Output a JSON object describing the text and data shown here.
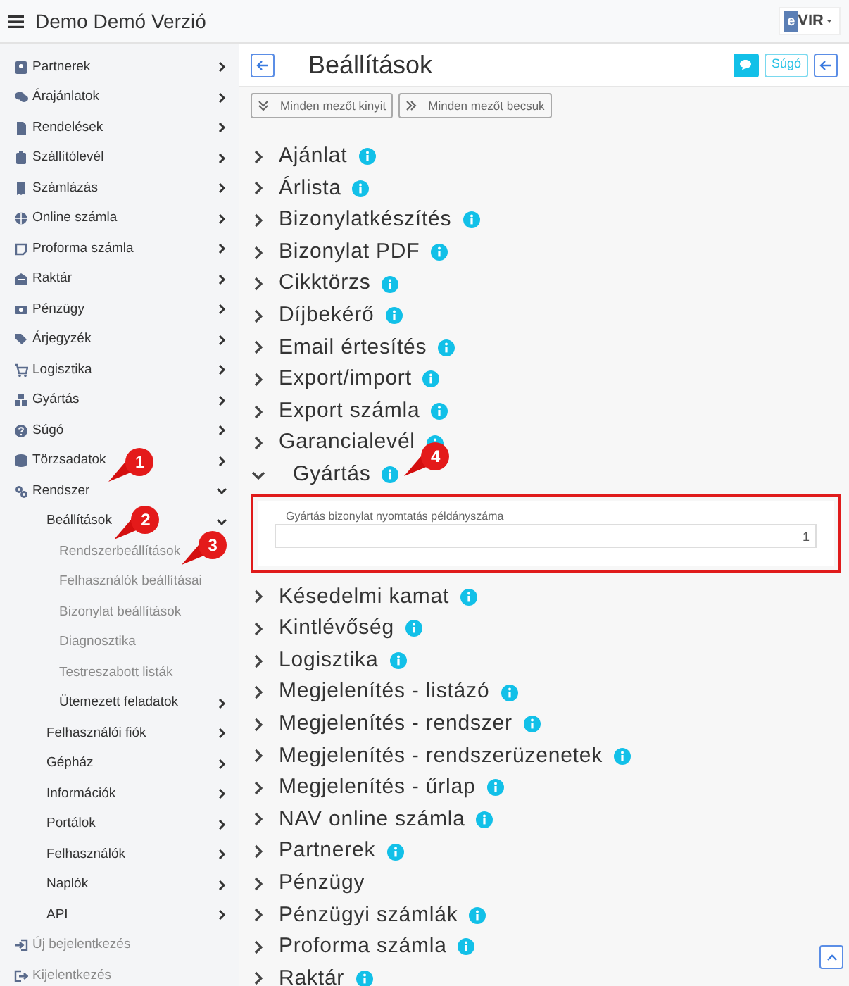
{
  "header": {
    "title": "Demo Demó Verzió",
    "logo": {
      "prefix": "e",
      "text": "VIR"
    }
  },
  "sidebar": {
    "items": [
      {
        "label": "Partnerek",
        "expanded": false
      },
      {
        "label": "Árajánlatok",
        "expanded": false
      },
      {
        "label": "Rendelések",
        "expanded": false
      },
      {
        "label": "Szállítólevél",
        "expanded": false
      },
      {
        "label": "Számlázás",
        "expanded": false
      },
      {
        "label": "Online számla",
        "expanded": false
      },
      {
        "label": "Proforma számla",
        "expanded": false
      },
      {
        "label": "Raktár",
        "expanded": false
      },
      {
        "label": "Pénzügy",
        "expanded": false
      },
      {
        "label": "Árjegyzék",
        "expanded": false
      },
      {
        "label": "Logisztika",
        "expanded": false
      },
      {
        "label": "Gyártás",
        "expanded": false
      },
      {
        "label": "Súgó",
        "expanded": false
      },
      {
        "label": "Törzsadatok",
        "expanded": false
      },
      {
        "label": "Rendszer",
        "expanded": true,
        "children": [
          {
            "label": "Beállítások",
            "expanded": true,
            "children": [
              {
                "label": "Rendszerbeállítások"
              },
              {
                "label": "Felhasználók beállításai"
              },
              {
                "label": "Bizonylat beállítások"
              },
              {
                "label": "Diagnosztika"
              },
              {
                "label": "Testreszabott listák"
              },
              {
                "label": "Ütemezett feladatok",
                "expanded": false
              }
            ]
          },
          {
            "label": "Felhasználói fiók",
            "expanded": false
          },
          {
            "label": "Gépház",
            "expanded": false
          },
          {
            "label": "Információk",
            "expanded": false
          },
          {
            "label": "Portálok",
            "expanded": false
          },
          {
            "label": "Felhasználók",
            "expanded": false
          },
          {
            "label": "Naplók",
            "expanded": false
          },
          {
            "label": "API",
            "expanded": false
          }
        ]
      }
    ],
    "footer_items": [
      {
        "label": "Új bejelentkezés"
      },
      {
        "label": "Kijelentkezés"
      }
    ]
  },
  "page": {
    "title": "Beállítások",
    "help_button": "Súgó",
    "toolbar": [
      "Minden mezőt kinyit",
      "Minden mezőt becsuk"
    ]
  },
  "sections": [
    {
      "label": "Ajánlat",
      "info": true,
      "expanded": false
    },
    {
      "label": "Árlista",
      "info": true,
      "expanded": false
    },
    {
      "label": "Bizonylatkészítés",
      "info": true,
      "expanded": false
    },
    {
      "label": "Bizonylat PDF",
      "info": true,
      "expanded": false
    },
    {
      "label": "Cikktörzs",
      "info": true,
      "expanded": false
    },
    {
      "label": "Díjbekérő",
      "info": true,
      "expanded": false
    },
    {
      "label": "Email értesítés",
      "info": true,
      "expanded": false
    },
    {
      "label": "Export/import",
      "info": true,
      "expanded": false
    },
    {
      "label": "Export számla",
      "info": true,
      "expanded": false
    },
    {
      "label": "Garancialevél",
      "info": true,
      "expanded": false
    },
    {
      "label": "Gyártás",
      "info": true,
      "expanded": true,
      "fields": [
        {
          "label": "Gyártás bizonylat nyomtatás példányszáma",
          "value": "1"
        }
      ]
    },
    {
      "label": "Késedelmi kamat",
      "info": true,
      "expanded": false
    },
    {
      "label": "Kintlévőség",
      "info": true,
      "expanded": false
    },
    {
      "label": "Logisztika",
      "info": true,
      "expanded": false
    },
    {
      "label": "Megjelenítés - listázó",
      "info": true,
      "expanded": false
    },
    {
      "label": "Megjelenítés - rendszer",
      "info": true,
      "expanded": false
    },
    {
      "label": "Megjelenítés - rendszerüzenetek",
      "info": true,
      "expanded": false
    },
    {
      "label": "Megjelenítés - űrlap",
      "info": true,
      "expanded": false
    },
    {
      "label": "NAV online számla",
      "info": true,
      "expanded": false
    },
    {
      "label": "Partnerek",
      "info": true,
      "expanded": false
    },
    {
      "label": "Pénzügy",
      "info": false,
      "expanded": false
    },
    {
      "label": "Pénzügyi számlák",
      "info": true,
      "expanded": false
    },
    {
      "label": "Proforma számla",
      "info": true,
      "expanded": false
    },
    {
      "label": "Raktár",
      "info": true,
      "expanded": false
    }
  ],
  "callouts": [
    "1",
    "2",
    "3",
    "4"
  ]
}
